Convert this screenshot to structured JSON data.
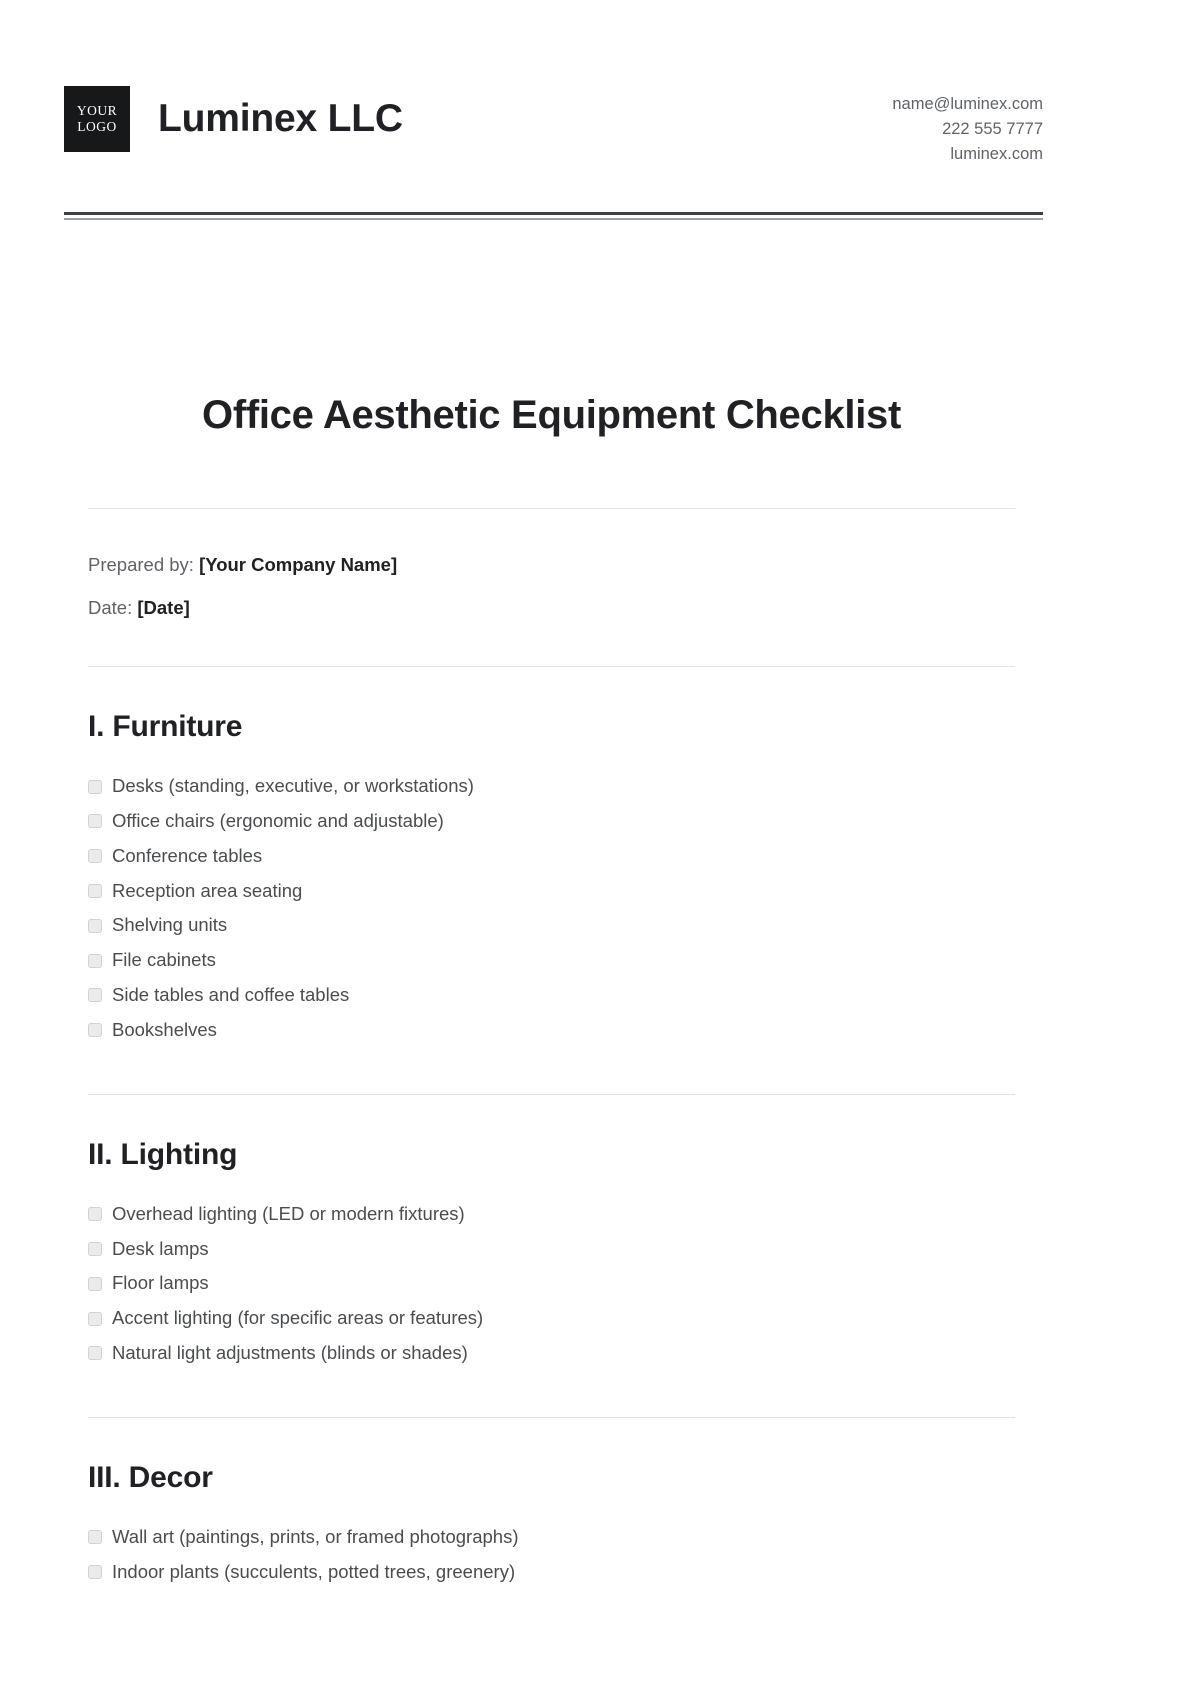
{
  "letterhead": {
    "logo": {
      "line1": "YOUR",
      "line2": "LOGO"
    },
    "company_name": "Luminex LLC",
    "contact": {
      "email": "name@luminex.com",
      "phone": "222 555 7777",
      "website": "luminex.com"
    }
  },
  "document": {
    "title": "Office Aesthetic Equipment Checklist",
    "meta": {
      "prepared_by_label": "Prepared by:",
      "prepared_by_value": "[Your Company Name]",
      "date_label": "Date:",
      "date_value": "[Date]"
    },
    "sections": [
      {
        "heading": "I. Furniture",
        "items": [
          "Desks (standing, executive, or workstations)",
          "Office chairs (ergonomic and adjustable)",
          "Conference tables",
          "Reception area seating",
          "Shelving units",
          "File cabinets",
          "Side tables and coffee tables",
          "Bookshelves"
        ]
      },
      {
        "heading": "II. Lighting",
        "items": [
          "Overhead lighting (LED or modern fixtures)",
          "Desk lamps",
          "Floor lamps",
          "Accent lighting (for specific areas or features)",
          "Natural light adjustments (blinds or shades)"
        ]
      },
      {
        "heading": "III. Decor",
        "items": [
          "Wall art (paintings, prints, or framed photographs)",
          "Indoor plants (succulents, potted trees, greenery)"
        ]
      }
    ]
  },
  "colors": {
    "logo_background": "#17181a",
    "title_text": "#202124",
    "body_text": "#4a4d50",
    "muted_text": "#5f6368",
    "divider": "#e3e4e6",
    "rule_dark": "#3c4043",
    "rule_light": "#9aa0a6",
    "checkbox_fill": "#ebebec",
    "checkbox_border": "#d0d2d4"
  }
}
